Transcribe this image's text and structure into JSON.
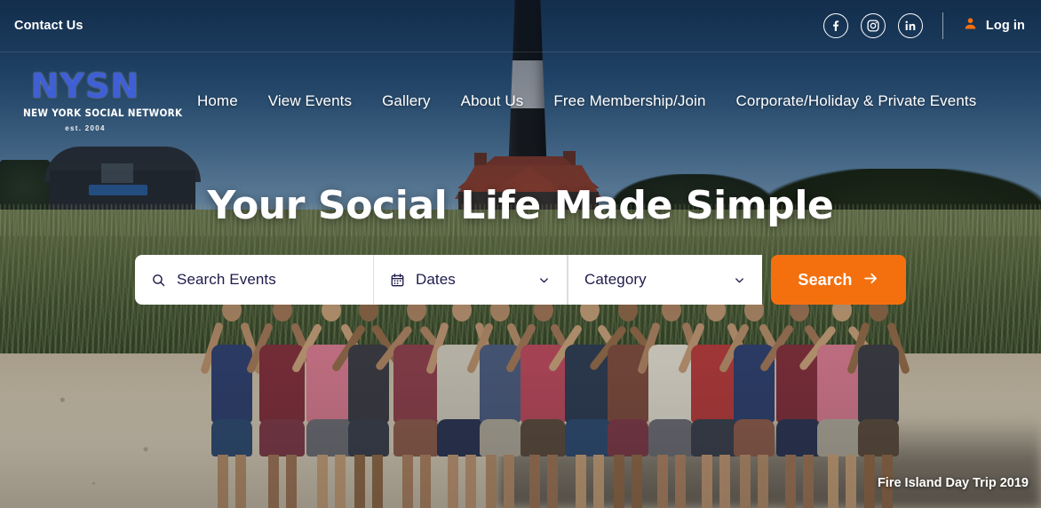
{
  "topbar": {
    "contact_label": "Contact Us",
    "social": [
      {
        "name": "facebook-icon",
        "label": "Facebook"
      },
      {
        "name": "instagram-icon",
        "label": "Instagram"
      },
      {
        "name": "linkedin-icon",
        "label": "LinkedIn"
      }
    ],
    "login_label": "Log in",
    "login_icon": "user-icon"
  },
  "logo": {
    "main": "NYSN",
    "sub": "NEW YORK SOCIAL NETWORK",
    "est": "est. 2004"
  },
  "nav": {
    "items": [
      {
        "label": "Home"
      },
      {
        "label": "View Events"
      },
      {
        "label": "Gallery"
      },
      {
        "label": "About Us"
      },
      {
        "label": "Free Membership/Join"
      },
      {
        "label": "Corporate/Holiday & Private Events"
      }
    ]
  },
  "hero": {
    "title": "Your Social Life Made Simple",
    "caption": "Fire Island Day Trip 2019"
  },
  "search": {
    "events_placeholder": "Search Events",
    "events_icon": "search-icon",
    "dates_label": "Dates",
    "dates_icon": "calendar-icon",
    "dates_chevron": "chevron-down-icon",
    "category_label": "Category",
    "category_chevron": "chevron-down-icon",
    "button_label": "Search",
    "button_icon": "arrow-right-icon"
  },
  "colors": {
    "accent_orange": "#f4700f",
    "logo_blue": "#3f5fd6",
    "field_text": "#1e1b4b",
    "header_blue": "#37587f"
  }
}
